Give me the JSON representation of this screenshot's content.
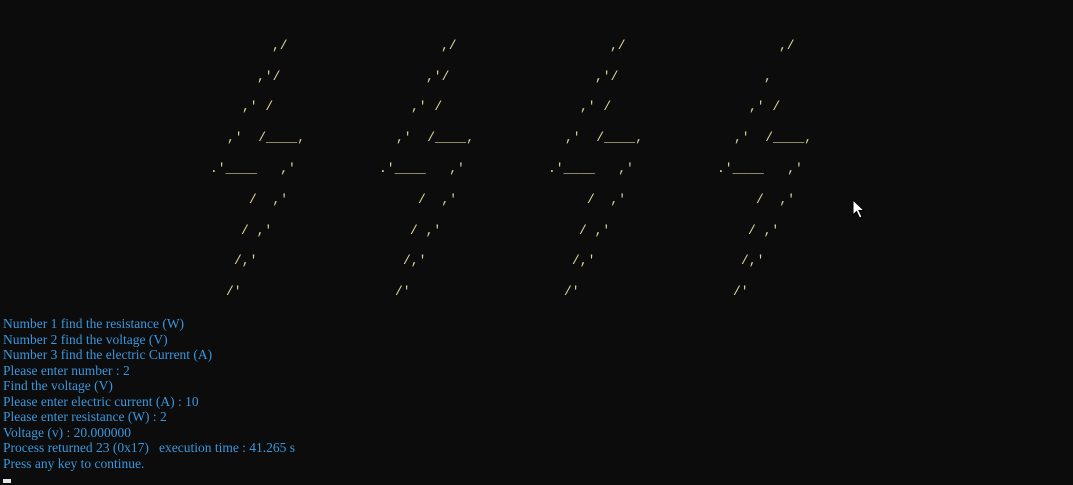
{
  "art": {
    "bolts": [
      [
        ",/",
        ",'/",
        ",' /",
        ",'  /____,",
        ".'____   ,'",
        "/  ,'",
        "/ ,'",
        "/,'",
        "/'"
      ],
      [
        ",/",
        ",'/",
        ",' /",
        ",'  /____,",
        ".'____   ,'",
        "/  ,'",
        "/ ,'",
        "/,'",
        "/'"
      ],
      [
        ",/",
        ",'/",
        ",' /",
        ",'  /____,",
        ".'____   ,'",
        "/  ,'",
        "/ ,'",
        "/,'",
        "/'"
      ],
      [
        ",/",
        ",",
        ",' /",
        ",'  /____,",
        ".'____   ,'",
        "/  ,'",
        "/ ,'",
        "/,'",
        "/'"
      ]
    ]
  },
  "console": {
    "lines": [
      "Number 1 find the resistance (W)",
      "Number 2 find the voltage (V)",
      "Number 3 find the electric Current (A)",
      "Please enter number : 2",
      "Find the voltage (V)",
      "Please enter electric current (A) : 10",
      "Please enter resistance (W) : 2",
      "Voltage (v) : 20.000000",
      "Process returned 23 (0x17)   execution time : 41.265 s",
      "Press any key to continue."
    ]
  },
  "colors": {
    "background": "#0c0c0c",
    "art": "#e0d8a0",
    "text": "#3a96dd"
  },
  "icons": {
    "cursor": "mouse-pointer-icon"
  }
}
